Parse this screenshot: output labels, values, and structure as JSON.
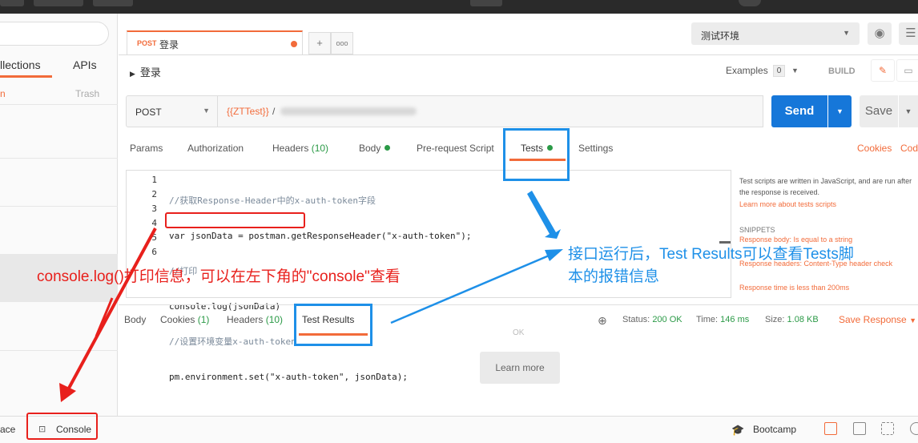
{
  "request_tab": {
    "method": "POST",
    "name": "登录"
  },
  "tab_add": "+",
  "tab_more": "ooo",
  "environment": {
    "selected": "测试环境"
  },
  "sidebar": {
    "tabs": [
      "llections",
      "APIs"
    ],
    "sub_left": "n",
    "sub_right": "Trash"
  },
  "request": {
    "name": "登录",
    "examples_label": "Examples",
    "examples_count": "0",
    "build_label": "BUILD",
    "method": "POST",
    "url_var": "{{ZTTest}}",
    "url_rest": "/",
    "send_label": "Send",
    "save_label": "Save"
  },
  "req_tabs": {
    "params": "Params",
    "authorization": "Authorization",
    "headers": "Headers",
    "headers_count": "(10)",
    "body": "Body",
    "prerequest": "Pre-request Script",
    "tests": "Tests",
    "settings": "Settings",
    "cookies": "Cookies",
    "code": "Code"
  },
  "editor": {
    "line_numbers": [
      "1",
      "2",
      "3",
      "4",
      "5",
      "6"
    ],
    "lines": [
      "//获取Response-Header中的x-auth-token字段",
      "var jsonData = postman.getResponseHeader(\"x-auth-token\");",
      "//打印",
      "console.log(jsonData)",
      "//设置环境变量x-auth-token",
      "pm.environment.set(\"x-auth-token\", jsonData);"
    ]
  },
  "snippets_panel": {
    "intro": "Test scripts are written in JavaScript, and are run after the response is received.",
    "learn_link": "Learn more about tests scripts",
    "heading": "SNIPPETS",
    "items": [
      "Response body: Is equal to a string",
      "Response headers: Content-Type header check",
      "Response time is less than 200ms"
    ]
  },
  "response": {
    "tabs": {
      "body": "Body",
      "cookies": "Cookies",
      "cookies_count": "(1)",
      "headers": "Headers",
      "headers_count": "(10)",
      "test_results": "Test Results"
    },
    "status_label": "Status:",
    "status_value": "200 OK",
    "time_label": "Time:",
    "time_value": "146 ms",
    "size_label": "Size:",
    "size_value": "1.08 KB",
    "save_response": "Save Response",
    "ok_faint": "OK",
    "learn_more": "Learn more"
  },
  "bottom_bar": {
    "left_partial": "ace",
    "console": "Console",
    "bootcamp": "Bootcamp"
  },
  "annotations": {
    "red_note": "console.log()打印信息，可以在左下角的\"console\"查看",
    "blue_note_line1": "接口运行后，Test Results可以查看Tests脚",
    "blue_note_line2": "本的报错信息"
  },
  "colors": {
    "accent_orange": "#f26b3a",
    "send_blue": "#1677d9",
    "annotation_red": "#e8201c",
    "annotation_blue": "#1e90e8",
    "status_green": "#2b9a47"
  }
}
